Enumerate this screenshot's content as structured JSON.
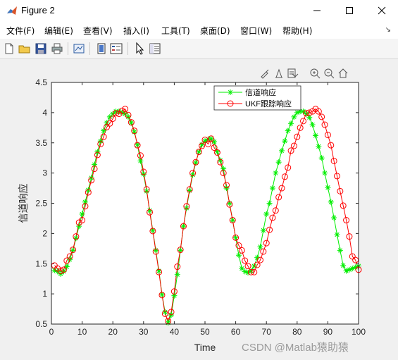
{
  "window": {
    "title": "Figure 2"
  },
  "menu": [
    "文件(F)",
    "编辑(E)",
    "查看(V)",
    "插入(I)",
    "工具(T)",
    "桌面(D)",
    "窗口(W)",
    "帮助(H)"
  ],
  "toolbar": {
    "icons": [
      "new-file-icon",
      "open-folder-icon",
      "save-icon",
      "print-icon",
      "link-plot-icon",
      "colorbar-icon",
      "legend-icon",
      "pointer-icon",
      "property-inspector-icon"
    ]
  },
  "axes_toolbar": {
    "icons": [
      "brush-icon",
      "data-tip-icon",
      "export-icon",
      "zoom-in-icon",
      "zoom-out-icon",
      "home-icon"
    ]
  },
  "watermark": "CSDN @Matlab猿助猿",
  "colors": {
    "series1": "#00ee00",
    "series2": "#ff0000",
    "axis": "#262626",
    "background": "#f0f0f0"
  },
  "chart_data": {
    "type": "line",
    "xlabel": "Time",
    "ylabel": "信道响应",
    "xlim": [
      0,
      100
    ],
    "ylim": [
      0.5,
      4.5
    ],
    "xticks": [
      "0",
      "10",
      "20",
      "30",
      "40",
      "50",
      "60",
      "70",
      "80",
      "90",
      "100"
    ],
    "yticks": [
      "0.5",
      "1",
      "1.5",
      "2",
      "2.5",
      "3",
      "3.5",
      "4",
      "4.5"
    ],
    "grid": false,
    "legend_position": "top-right",
    "series": [
      {
        "name": "信道响应",
        "color": "#00ee00",
        "marker": "asterisk",
        "x": [
          1,
          2,
          3,
          4,
          5,
          6,
          7,
          8,
          9,
          10,
          11,
          12,
          13,
          14,
          15,
          16,
          17,
          18,
          19,
          20,
          21,
          22,
          23,
          24,
          25,
          26,
          27,
          28,
          29,
          30,
          31,
          32,
          33,
          34,
          35,
          36,
          37,
          38,
          39,
          40,
          41,
          42,
          43,
          44,
          45,
          46,
          47,
          48,
          49,
          50,
          51,
          52,
          53,
          54,
          55,
          56,
          57,
          58,
          59,
          60,
          61,
          62,
          63,
          64,
          65,
          66,
          67,
          68,
          69,
          70,
          71,
          72,
          73,
          74,
          75,
          76,
          77,
          78,
          79,
          80,
          81,
          82,
          83,
          84,
          85,
          86,
          87,
          88,
          89,
          90,
          91,
          92,
          93,
          94,
          95,
          96,
          97,
          98,
          99,
          100
        ],
        "y": [
          1.39,
          1.37,
          1.33,
          1.37,
          1.45,
          1.57,
          1.72,
          1.92,
          2.12,
          2.32,
          2.52,
          2.72,
          2.92,
          3.14,
          3.35,
          3.53,
          3.7,
          3.83,
          3.93,
          3.98,
          4.02,
          4.02,
          4.0,
          3.98,
          3.93,
          3.83,
          3.68,
          3.47,
          3.2,
          2.98,
          2.7,
          2.38,
          2.05,
          1.72,
          1.38,
          0.99,
          0.7,
          0.52,
          0.65,
          0.97,
          1.32,
          1.72,
          2.12,
          2.42,
          2.71,
          2.97,
          3.17,
          3.35,
          3.47,
          3.53,
          3.56,
          3.57,
          3.52,
          3.35,
          3.21,
          3.07,
          2.75,
          2.5,
          2.22,
          1.93,
          1.64,
          1.42,
          1.37,
          1.35,
          1.38,
          1.46,
          1.6,
          1.78,
          2.05,
          2.32,
          2.5,
          2.75,
          3.0,
          3.18,
          3.37,
          3.53,
          3.7,
          3.82,
          3.93,
          4.0,
          4.02,
          4.02,
          3.98,
          3.92,
          3.8,
          3.62,
          3.44,
          3.25,
          3.0,
          2.76,
          2.52,
          2.26,
          1.98,
          1.72,
          1.47,
          1.38,
          1.4,
          1.42,
          1.44,
          1.46
        ]
      },
      {
        "name": "UKF跟踪响应",
        "color": "#ff0000",
        "marker": "circle",
        "x": [
          1,
          2,
          3,
          4,
          5,
          6,
          7,
          8,
          9,
          10,
          11,
          12,
          13,
          14,
          15,
          16,
          17,
          18,
          19,
          20,
          21,
          22,
          23,
          24,
          25,
          26,
          27,
          28,
          29,
          30,
          31,
          32,
          33,
          34,
          35,
          36,
          37,
          38,
          39,
          40,
          41,
          42,
          43,
          44,
          45,
          46,
          47,
          48,
          49,
          50,
          51,
          52,
          53,
          54,
          55,
          56,
          57,
          58,
          59,
          60,
          61,
          62,
          63,
          64,
          65,
          66,
          67,
          68,
          69,
          70,
          71,
          72,
          73,
          74,
          75,
          76,
          77,
          78,
          79,
          80,
          81,
          82,
          83,
          84,
          85,
          86,
          87,
          88,
          89,
          90,
          91,
          92,
          93,
          94,
          95,
          96,
          97,
          98,
          99,
          100
        ],
        "y": [
          1.47,
          1.42,
          1.38,
          1.4,
          1.55,
          1.62,
          1.73,
          1.95,
          2.18,
          2.22,
          2.45,
          2.68,
          2.88,
          3.07,
          3.3,
          3.48,
          3.6,
          3.76,
          3.82,
          3.9,
          3.99,
          3.98,
          4.03,
          4.06,
          3.96,
          3.84,
          3.7,
          3.46,
          3.29,
          3.02,
          2.73,
          2.35,
          2.04,
          1.7,
          1.36,
          0.98,
          0.67,
          0.55,
          0.7,
          1.04,
          1.45,
          1.73,
          2.12,
          2.45,
          2.73,
          3.0,
          3.18,
          3.35,
          3.45,
          3.55,
          3.48,
          3.57,
          3.42,
          3.34,
          3.18,
          3.0,
          2.8,
          2.48,
          2.22,
          1.93,
          1.8,
          1.72,
          1.55,
          1.46,
          1.36,
          1.36,
          1.48,
          1.56,
          1.7,
          1.84,
          2.06,
          2.26,
          2.38,
          2.6,
          2.75,
          2.94,
          3.09,
          3.37,
          3.45,
          3.6,
          3.75,
          3.86,
          3.99,
          4.0,
          4.02,
          4.06,
          4.02,
          3.93,
          3.8,
          3.63,
          3.46,
          3.2,
          2.95,
          2.7,
          2.46,
          2.22,
          1.95,
          1.62,
          1.56,
          1.4
        ]
      }
    ]
  }
}
